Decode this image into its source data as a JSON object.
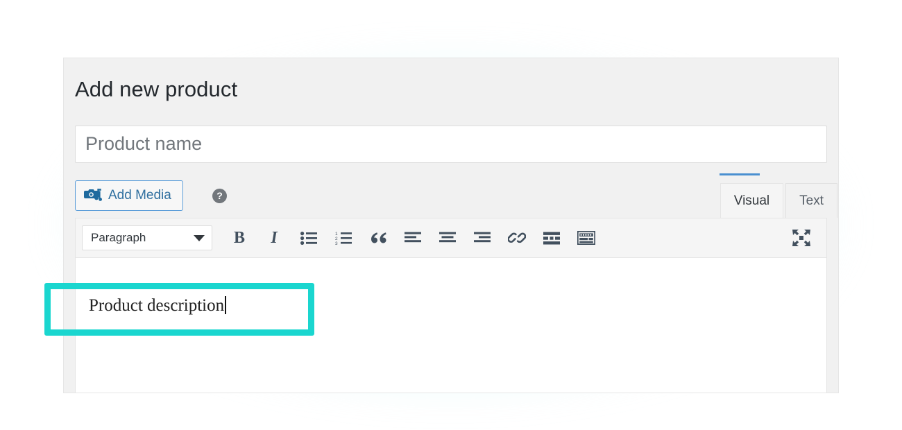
{
  "page": {
    "title": "Add new product",
    "background_color": "#ffffff",
    "card_background": "#f1f1f1"
  },
  "title_input": {
    "placeholder": "Product name",
    "value": ""
  },
  "media_row": {
    "add_media_label": "Add Media",
    "add_media_icon": "camera-music-icon",
    "add_media_border_color": "#5b9dd9",
    "help_icon": "help-circle-icon",
    "help_label": "?"
  },
  "tabs": {
    "items": [
      {
        "label": "Visual",
        "name": "tab-visual",
        "active": true
      },
      {
        "label": "Text",
        "name": "tab-text",
        "active": false
      }
    ],
    "accent_color": "#4a8fd0"
  },
  "toolbar": {
    "format_select": {
      "value": "Paragraph",
      "caret_icon": "chevron-down-icon"
    },
    "buttons": [
      {
        "name": "bold-button",
        "label": "B",
        "icon": "bold-icon"
      },
      {
        "name": "italic-button",
        "label": "I",
        "icon": "italic-icon"
      },
      {
        "name": "bulleted-list-button",
        "label": "",
        "icon": "bulleted-list-icon"
      },
      {
        "name": "numbered-list-button",
        "label": "",
        "icon": "numbered-list-icon"
      },
      {
        "name": "blockquote-button",
        "label": "",
        "icon": "blockquote-icon"
      },
      {
        "name": "align-left-button",
        "label": "",
        "icon": "align-left-icon"
      },
      {
        "name": "align-center-button",
        "label": "",
        "icon": "align-center-icon"
      },
      {
        "name": "align-right-button",
        "label": "",
        "icon": "align-right-icon"
      },
      {
        "name": "insert-link-button",
        "label": "",
        "icon": "link-icon"
      },
      {
        "name": "read-more-button",
        "label": "",
        "icon": "insert-read-more-icon"
      },
      {
        "name": "toolbar-toggle-button",
        "label": "",
        "icon": "keyboard-toolbar-toggle-icon"
      },
      {
        "name": "fullscreen-button",
        "label": "",
        "icon": "distraction-free-fullscreen-icon"
      }
    ],
    "icon_color": "#42505e"
  },
  "editor_body": {
    "text": "Product description",
    "cursor_visible": true
  },
  "annotation": {
    "highlight_color": "#1ad6cf",
    "target": "editor-body-text"
  }
}
